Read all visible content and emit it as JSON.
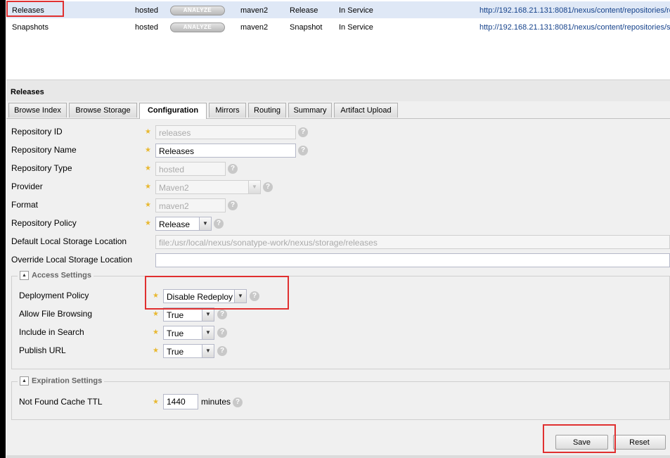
{
  "repositories": [
    {
      "name": "Releases",
      "type": "hosted",
      "analyze": "ANALYZE",
      "format": "maven2",
      "policy": "Release",
      "status": "In Service",
      "url": "http://192.168.21.131:8081/nexus/content/repositories/re"
    },
    {
      "name": "Snapshots",
      "type": "hosted",
      "analyze": "ANALYZE",
      "format": "maven2",
      "policy": "Snapshot",
      "status": "In Service",
      "url": "http://192.168.21.131:8081/nexus/content/repositories/s"
    }
  ],
  "panel": {
    "title": "Releases",
    "tabs": [
      "Browse Index",
      "Browse Storage",
      "Configuration",
      "Mirrors",
      "Routing",
      "Summary",
      "Artifact Upload"
    ],
    "active_tab": "Configuration"
  },
  "form": {
    "repository_id": {
      "label": "Repository ID",
      "value": "releases"
    },
    "repository_name": {
      "label": "Repository Name",
      "value": "Releases"
    },
    "repository_type": {
      "label": "Repository Type",
      "value": "hosted"
    },
    "provider": {
      "label": "Provider",
      "value": "Maven2"
    },
    "format": {
      "label": "Format",
      "value": "maven2"
    },
    "repository_policy": {
      "label": "Repository Policy",
      "value": "Release"
    },
    "default_storage": {
      "label": "Default Local Storage Location",
      "value": "file:/usr/local/nexus/sonatype-work/nexus/storage/releases"
    },
    "override_storage": {
      "label": "Override Local Storage Location",
      "value": ""
    }
  },
  "access": {
    "legend": "Access Settings",
    "deployment_policy": {
      "label": "Deployment Policy",
      "value": "Disable Redeploy"
    },
    "file_browsing": {
      "label": "Allow File Browsing",
      "value": "True"
    },
    "include_search": {
      "label": "Include in Search",
      "value": "True"
    },
    "publish_url": {
      "label": "Publish URL",
      "value": "True"
    }
  },
  "expiration": {
    "legend": "Expiration Settings",
    "not_found_ttl": {
      "label": "Not Found Cache TTL",
      "value": "1440",
      "unit": "minutes"
    }
  },
  "buttons": {
    "save": "Save",
    "reset": "Reset"
  },
  "icons": {
    "help": "?",
    "star": "★",
    "dropdown": "▼",
    "collapse": "▲"
  },
  "colors": {
    "highlight": "#e03030",
    "selected_row": "#dfe8f6",
    "link": "#15428b",
    "required_star": "#e8b830"
  }
}
